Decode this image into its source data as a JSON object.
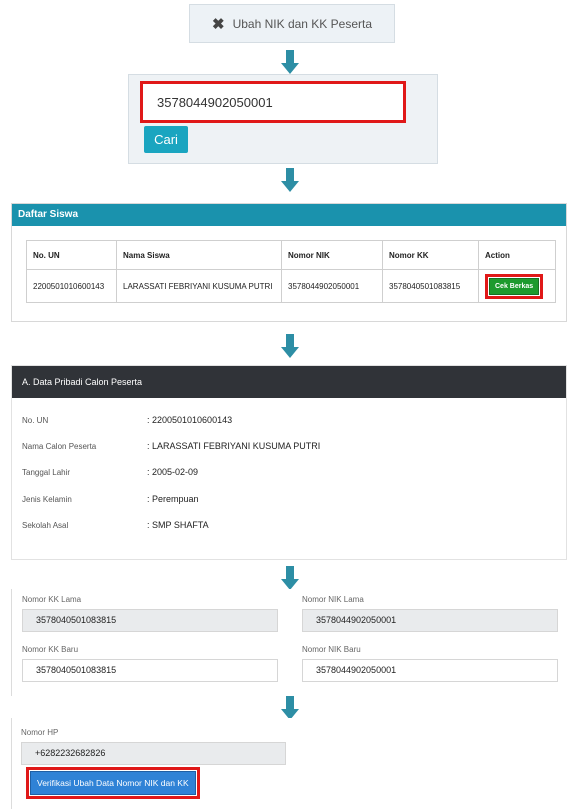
{
  "step1": {
    "button_label": "Ubah NIK dan KK Peserta",
    "icon": "close-icon"
  },
  "step2": {
    "search_value": "3578044902050001",
    "button_label": "Cari"
  },
  "step3": {
    "panel_title": "Daftar Siswa",
    "columns": [
      "No. UN",
      "Nama Siswa",
      "Nomor NIK",
      "Nomor KK",
      "Action"
    ],
    "rows": [
      {
        "no_un": "2200501010600143",
        "nama": "LARASSATI FEBRIYANI KUSUMA PUTRI",
        "nik": "3578044902050001",
        "kk": "3578040501083815",
        "action_label": "Cek Berkas"
      }
    ]
  },
  "step4": {
    "section_title": "A. Data Pribadi Calon Peserta",
    "fields": [
      {
        "label": "No. UN",
        "value": ": 2200501010600143"
      },
      {
        "label": "Nama Calon Peserta",
        "value": ": LARASSATI FEBRIYANI KUSUMA PUTRI"
      },
      {
        "label": "Tanggal Lahir",
        "value": ": 2005-02-09"
      },
      {
        "label": "Jenis Kelamin",
        "value": ": Perempuan"
      },
      {
        "label": "Sekolah Asal",
        "value": ": SMP SHAFTA"
      }
    ]
  },
  "step5": {
    "kk_lama_label": "Nomor KK Lama",
    "kk_lama_value": "3578040501083815",
    "nik_lama_label": "Nomor NIK Lama",
    "nik_lama_value": "3578044902050001",
    "kk_baru_label": "Nomor KK Baru",
    "kk_baru_value": "3578040501083815",
    "nik_baru_label": "Nomor NIK Baru",
    "nik_baru_value": "3578044902050001"
  },
  "step6": {
    "hp_label": "Nomor HP",
    "hp_value": "+6282232682826",
    "button_label": "Verifikasi Ubah Data Nomor NIK dan KK"
  },
  "colors": {
    "accent": "#1a92ad",
    "arrow": "#2d8ea5",
    "highlight": "#e01818",
    "success": "#1d9a2e",
    "primary": "#2f82d6"
  }
}
